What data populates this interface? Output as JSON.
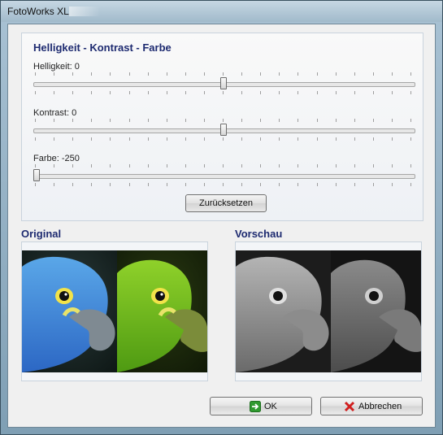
{
  "window": {
    "title": "FotoWorks XL"
  },
  "adjust": {
    "heading": "Helligkeit - Kontrast - Farbe",
    "brightness": {
      "label": "Helligkeit: 0",
      "value": 0,
      "min": -250,
      "max": 250
    },
    "contrast": {
      "label": "Kontrast: 0",
      "value": 0,
      "min": -250,
      "max": 250
    },
    "color": {
      "label": "Farbe: -250",
      "value": -250,
      "min": -250,
      "max": 250
    },
    "reset_label": "Zurücksetzen"
  },
  "original": {
    "label": "Original"
  },
  "preview": {
    "label": "Vorschau"
  },
  "buttons": {
    "ok_label": "OK",
    "cancel_label": "Abbrechen"
  },
  "icons": {
    "ok": "green-arrow-icon",
    "cancel": "red-x-icon"
  },
  "colors": {
    "heading": "#1d2a70",
    "ok_icon": "#2f9a2f",
    "cancel_icon": "#d01f1f"
  }
}
